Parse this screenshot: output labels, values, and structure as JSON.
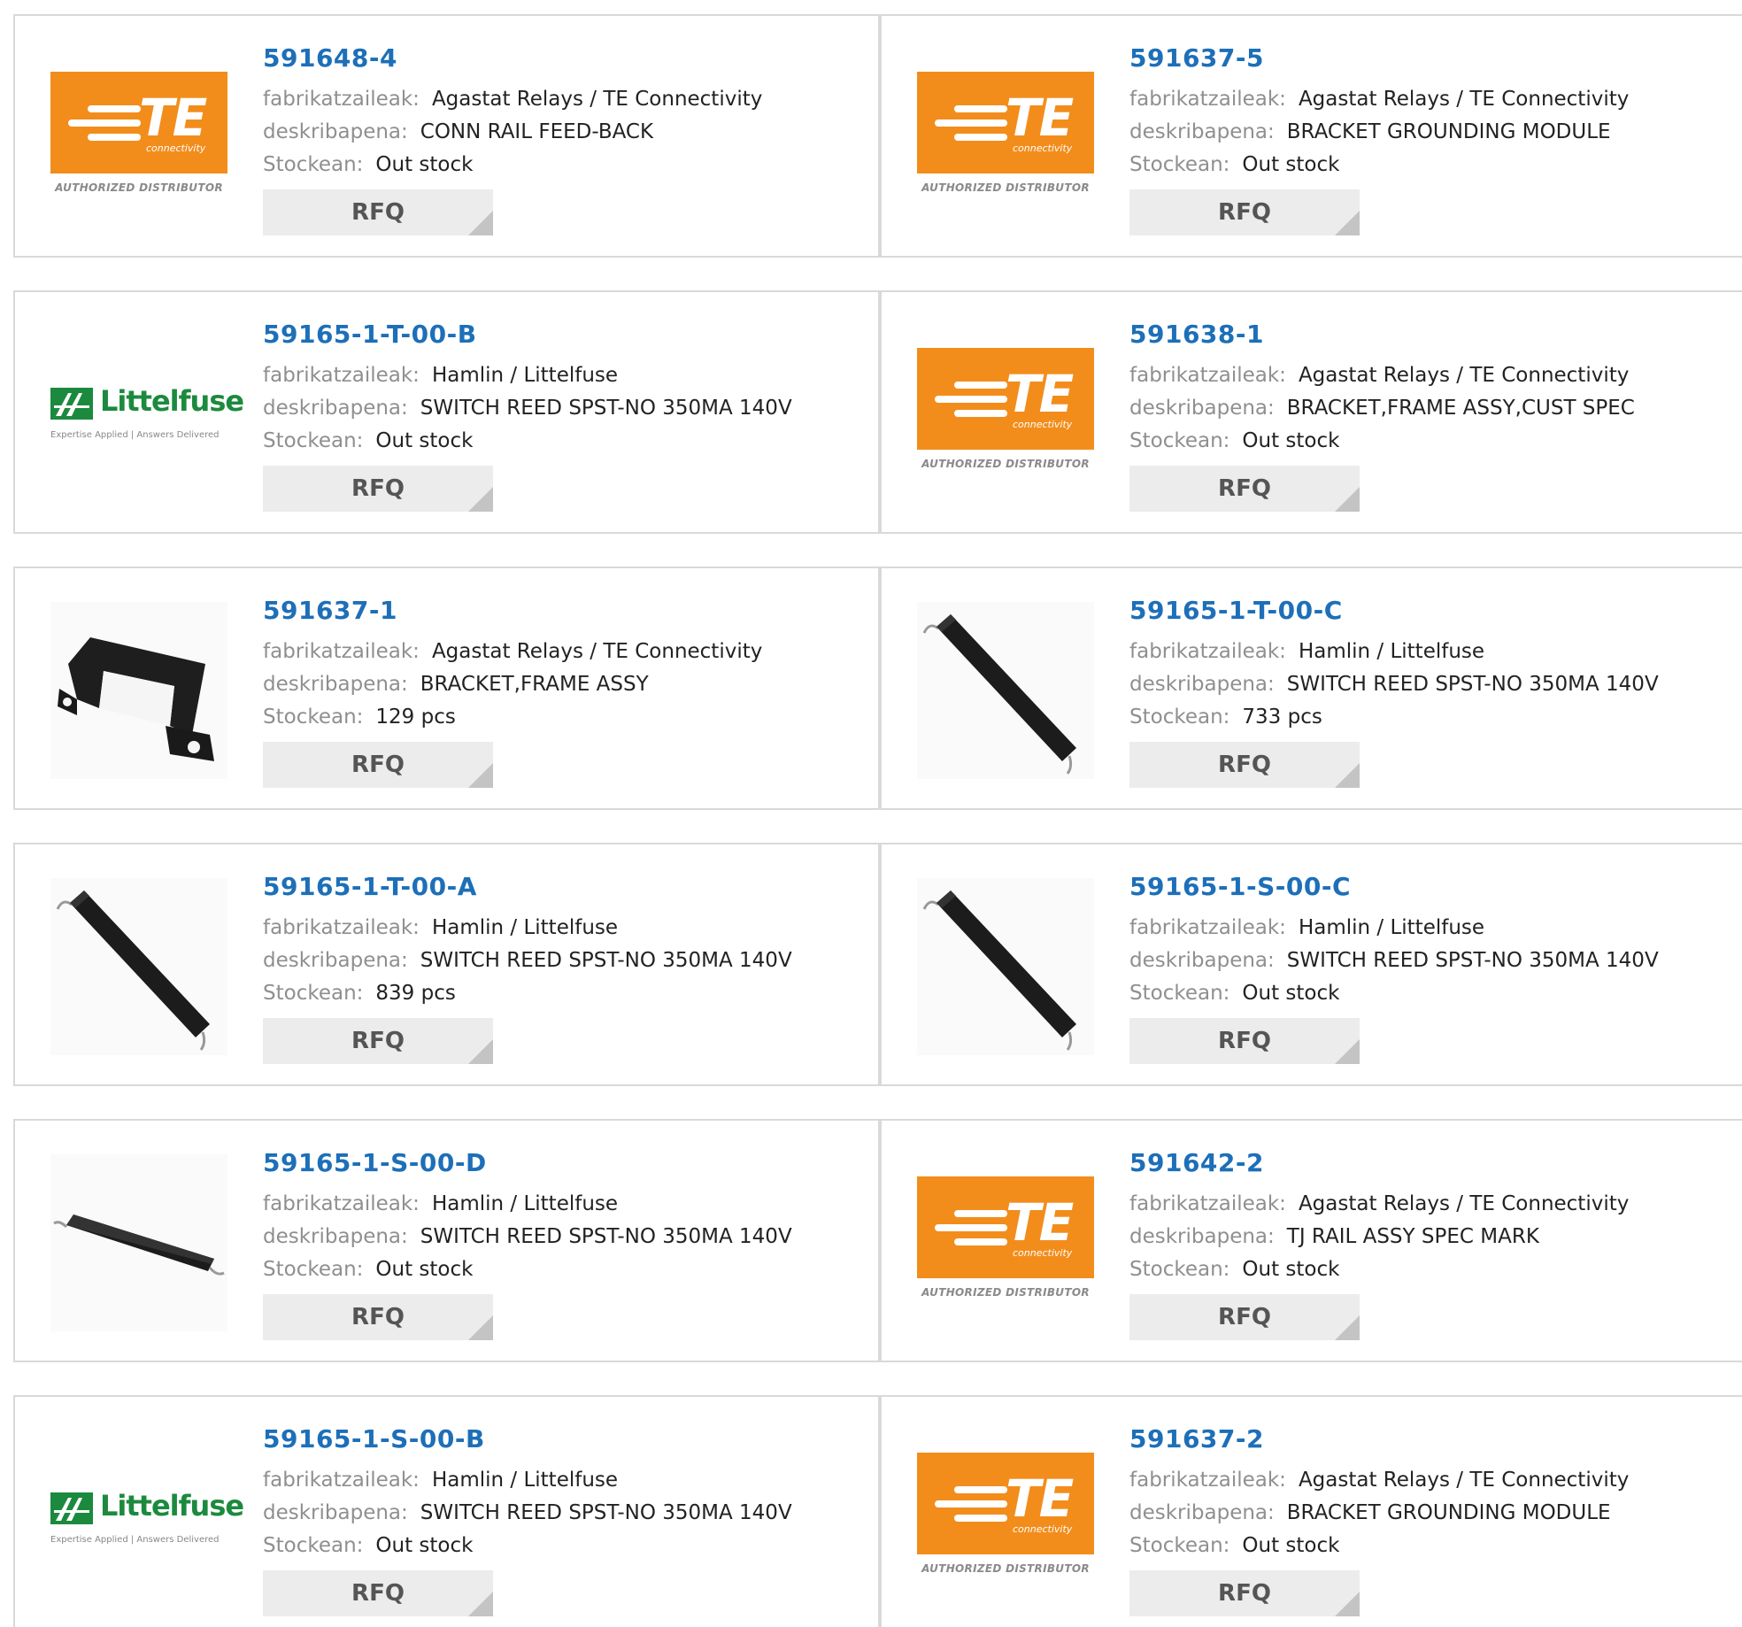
{
  "labels": {
    "manufacturer": "fabrikatzaileak:",
    "description": "deskribapena:",
    "stock": "Stockean:",
    "rfq": "RFQ"
  },
  "logos": {
    "te_text": "TE",
    "te_sub": "connectivity",
    "te_caption": "AUTHORIZED DISTRIBUTOR",
    "lf_name": "Littelfuse",
    "lf_tag": "Expertise Applied | Answers Delivered"
  },
  "colors": {
    "part_link": "#1d6fb8",
    "te_orange": "#f28d1c",
    "littelfuse_green": "#1c8a3e"
  },
  "products": [
    {
      "part": "591648-4",
      "manufacturer": "Agastat Relays / TE Connectivity",
      "description": "CONN RAIL FEED-BACK",
      "stock": "Out stock",
      "image": "te-logo"
    },
    {
      "part": "591637-5",
      "manufacturer": "Agastat Relays / TE Connectivity",
      "description": "BRACKET GROUNDING MODULE",
      "stock": "Out stock",
      "image": "te-logo"
    },
    {
      "part": "59165-1-T-00-B",
      "manufacturer": "Hamlin / Littelfuse",
      "description": "SWITCH REED SPST-NO 350MA 140V",
      "stock": "Out stock",
      "image": "littelfuse-logo"
    },
    {
      "part": "591638-1",
      "manufacturer": "Agastat Relays / TE Connectivity",
      "description": "BRACKET,FRAME ASSY,CUST SPEC",
      "stock": "Out stock",
      "image": "te-logo"
    },
    {
      "part": "591637-1",
      "manufacturer": "Agastat Relays / TE Connectivity",
      "description": "BRACKET,FRAME ASSY",
      "stock": "129 pcs",
      "image": "bracket-photo"
    },
    {
      "part": "59165-1-T-00-C",
      "manufacturer": "Hamlin / Littelfuse",
      "description": "SWITCH REED SPST-NO 350MA 140V",
      "stock": "733 pcs",
      "image": "reed-switch-diagonal"
    },
    {
      "part": "59165-1-T-00-A",
      "manufacturer": "Hamlin / Littelfuse",
      "description": "SWITCH REED SPST-NO 350MA 140V",
      "stock": "839 pcs",
      "image": "reed-switch-diagonal"
    },
    {
      "part": "59165-1-S-00-C",
      "manufacturer": "Hamlin / Littelfuse",
      "description": "SWITCH REED SPST-NO 350MA 140V",
      "stock": "Out stock",
      "image": "reed-switch-diagonal"
    },
    {
      "part": "59165-1-S-00-D",
      "manufacturer": "Hamlin / Littelfuse",
      "description": "SWITCH REED SPST-NO 350MA 140V",
      "stock": "Out stock",
      "image": "reed-switch-flat"
    },
    {
      "part": "591642-2",
      "manufacturer": "Agastat Relays / TE Connectivity",
      "description": "TJ RAIL ASSY SPEC MARK",
      "stock": "Out stock",
      "image": "te-logo"
    },
    {
      "part": "59165-1-S-00-B",
      "manufacturer": "Hamlin / Littelfuse",
      "description": "SWITCH REED SPST-NO 350MA 140V",
      "stock": "Out stock",
      "image": "littelfuse-logo"
    },
    {
      "part": "591637-2",
      "manufacturer": "Agastat Relays / TE Connectivity",
      "description": "BRACKET GROUNDING MODULE",
      "stock": "Out stock",
      "image": "te-logo"
    }
  ]
}
